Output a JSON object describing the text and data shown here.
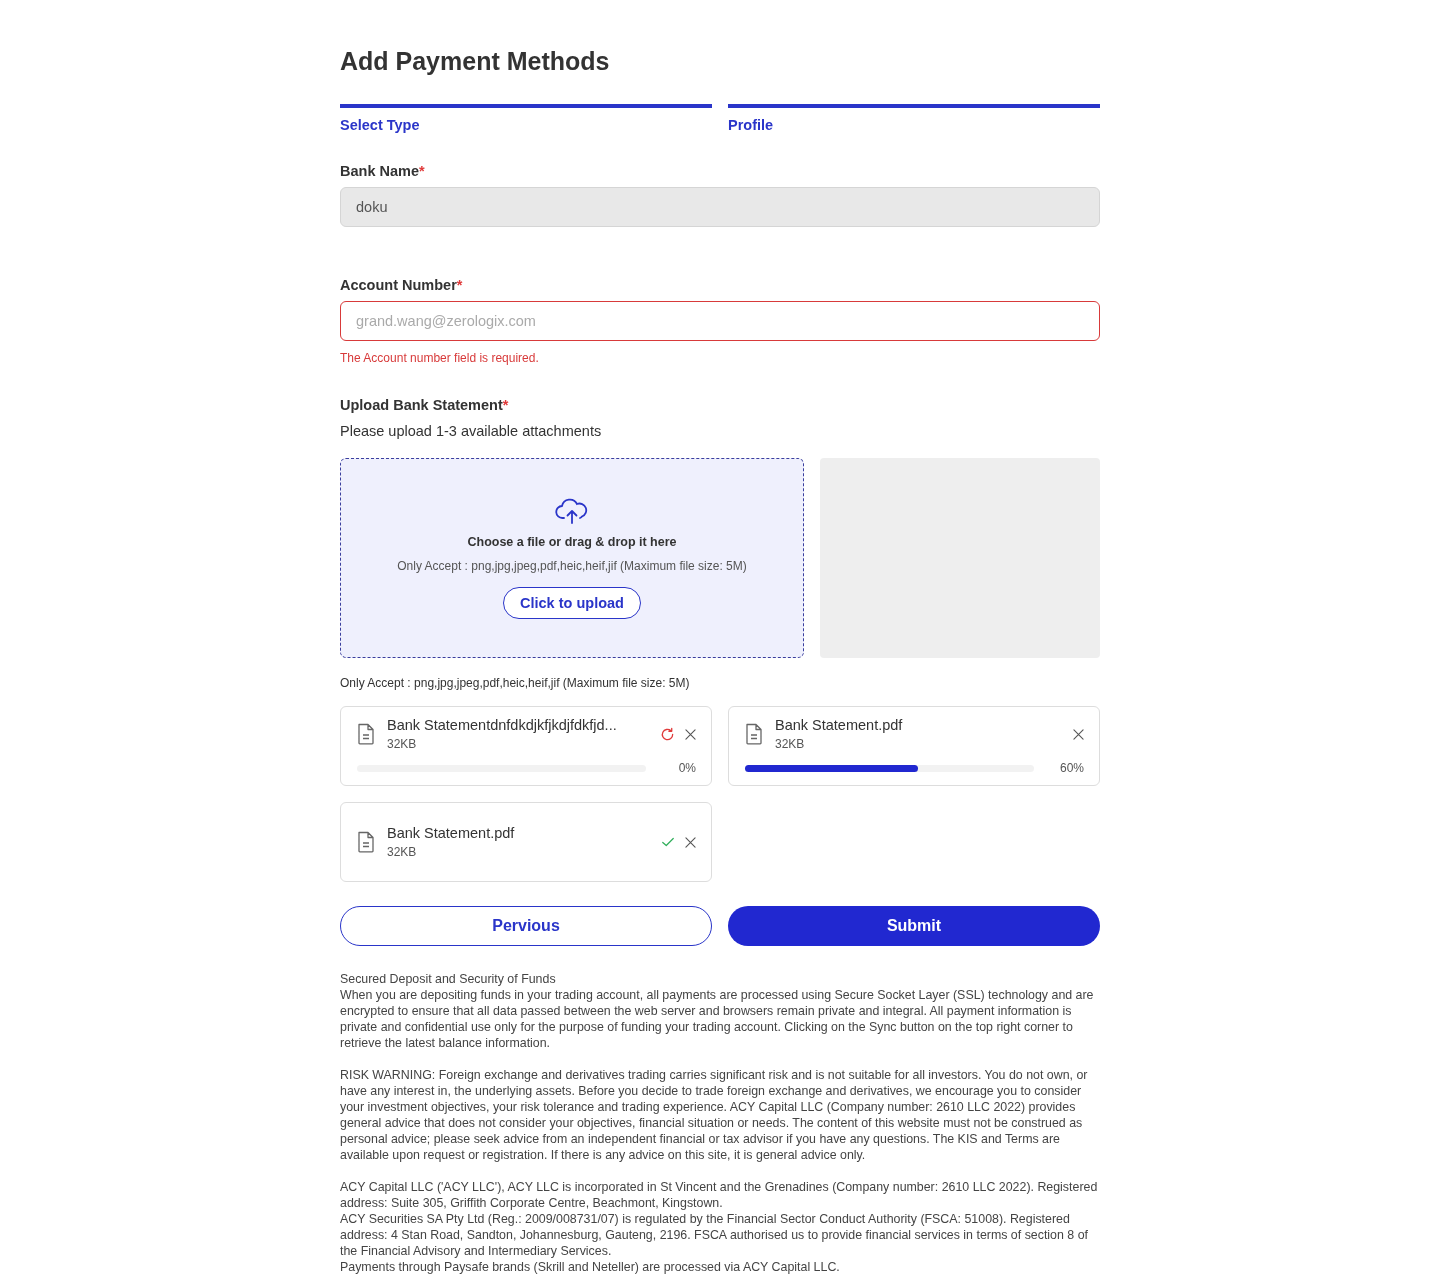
{
  "title": "Add Payment Methods",
  "steps": [
    {
      "label": "Select Type",
      "active": true
    },
    {
      "label": "Profile",
      "active": true
    }
  ],
  "bank_name": {
    "label": "Bank Name",
    "required_mark": "*",
    "value": "doku",
    "disabled": true
  },
  "account_number": {
    "label": "Account Number",
    "required_mark": "*",
    "placeholder": "grand.wang@zerologix.com",
    "error": "The Account number field is required."
  },
  "upload": {
    "label": "Upload Bank Statement",
    "required_mark": "*",
    "hint": "Please upload 1-3 available attachments",
    "dropzone_title": "Choose a file or drag & drop it here",
    "dropzone_accept": "Only Accept : png,jpg,jpeg,pdf,heic,heif,jif (Maximum file size: 5M)",
    "button": "Click to upload",
    "accept_note": "Only Accept : png,jpg,jpeg,pdf,heic,heif,jif (Maximum file size: 5M)"
  },
  "files": [
    {
      "name": "Bank Statementdnfdkdjkfjkdjfdkfjd...",
      "size": "32KB",
      "kind": "failed",
      "percent": "0%"
    },
    {
      "name": "Bank Statement.pdf",
      "size": "32KB",
      "kind": "uploading",
      "level": 0.6,
      "percent": "60%"
    },
    {
      "name": "Bank Statement.pdf",
      "size": "32KB",
      "kind": "done"
    }
  ],
  "buttons": {
    "previous": "Pervious",
    "submit": "Submit"
  },
  "notice": [
    [
      "Secured Deposit and Security of Funds",
      "When you are depositing funds in your trading account, all payments are processed using Secure Socket Layer (SSL) technology and are encrypted to ensure that all data passed between the web server and browsers remain private and integral. All payment information is private and confidential use only for the purpose of funding your trading account. Clicking on the Sync button on the top right corner to retrieve the latest balance information."
    ],
    [
      "RISK WARNING: Foreign exchange and derivatives trading carries significant risk and is not suitable for all investors. You do not own, or have any interest in, the underlying assets. Before you decide to trade foreign exchange and derivatives, we encourage you to consider your investment objectives, your risk tolerance and trading experience. ACY Capital LLC (Company number: 2610 LLC 2022) provides general advice that does not consider your objectives, financial situation or needs. The content of this website must not be construed as personal advice; please seek advice from an independent financial or tax advisor if you have any questions. The KIS and Terms are available upon request or registration. If there is any advice on this site, it is general advice only."
    ],
    [
      "ACY Capital LLC ('ACY LLC'), ACY LLC is incorporated in St Vincent and the Grenadines (Company number: 2610 LLC 2022). Registered address: Suite 305, Griffith Corporate Centre, Beachmont, Kingstown.",
      "ACY Securities SA Pty Ltd (Reg.: 2009/008731/07) is regulated by the Financial Sector Conduct Authority (FSCA: 51008). Registered address: 4 Stan Road, Sandton, Johannesburg, Gauteng, 2196. FSCA authorised us to provide financial services in terms of section 8 of the Financial Advisory and Intermediary Services.",
      "Payments through Paysafe brands (Skrill and Neteller) are processed via ACY Capital LLC."
    ]
  ]
}
